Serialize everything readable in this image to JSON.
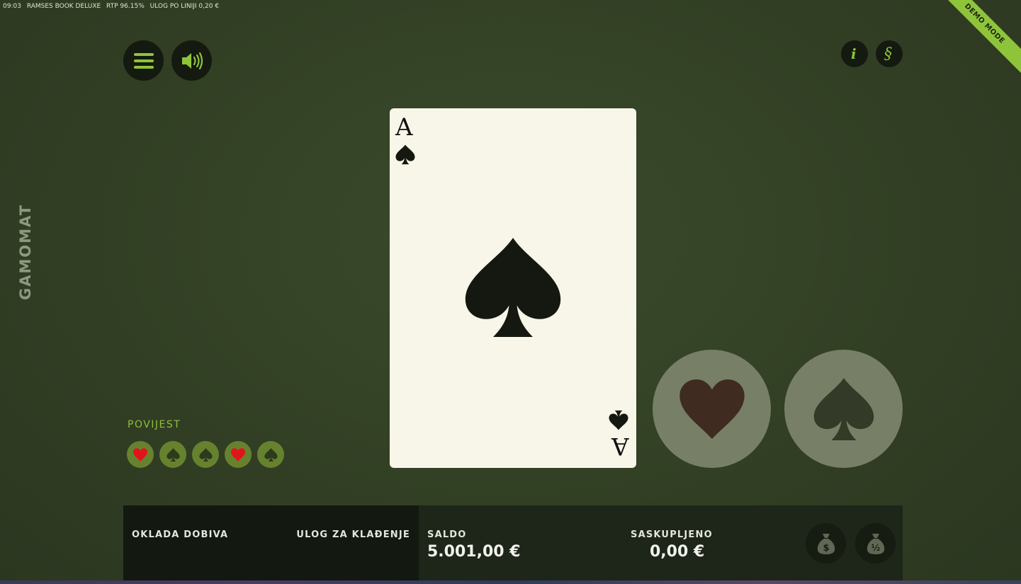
{
  "status_bar": {
    "time": "09:03",
    "game": "RAMSES BOOK DELUXE",
    "rtp": "RTP 96.15%",
    "stake": "ULOG PO LINIJI 0,20 €"
  },
  "ribbon": "DEMO MODE",
  "brand": "GAMOMAT",
  "toolbar": {
    "menu_icon": "hamburger-icon",
    "sound_icon": "speaker-icon",
    "info_icon": "info-icon",
    "paytable_icon": "paragraph-icon"
  },
  "card": {
    "rank": "A",
    "suit": "spades"
  },
  "choices": [
    {
      "name": "hearts",
      "color": "#3f2b20"
    },
    {
      "name": "spades",
      "color": "#333a28"
    }
  ],
  "history": {
    "label": "POVIJEST",
    "items": [
      "hearts",
      "spades",
      "spades",
      "hearts",
      "spades"
    ]
  },
  "panel": {
    "win_label": "OKLADA DOBIVA",
    "stake_label": "ULOG ZA KLAĐENJE",
    "balance_label": "SALDO",
    "balance_value": "5.001,00 €",
    "collected_label": "SASKUPLJENO",
    "collected_value": "0,00 €",
    "collect_all_icon": "money-bag-dollar-icon",
    "collect_half_icon": "money-bag-half-icon",
    "collect_half_text": "½"
  },
  "colors": {
    "accent": "#8ec43a",
    "heart_red": "#e0151a",
    "history_bg": "#66822f",
    "card_face": "#f8f6e8"
  }
}
